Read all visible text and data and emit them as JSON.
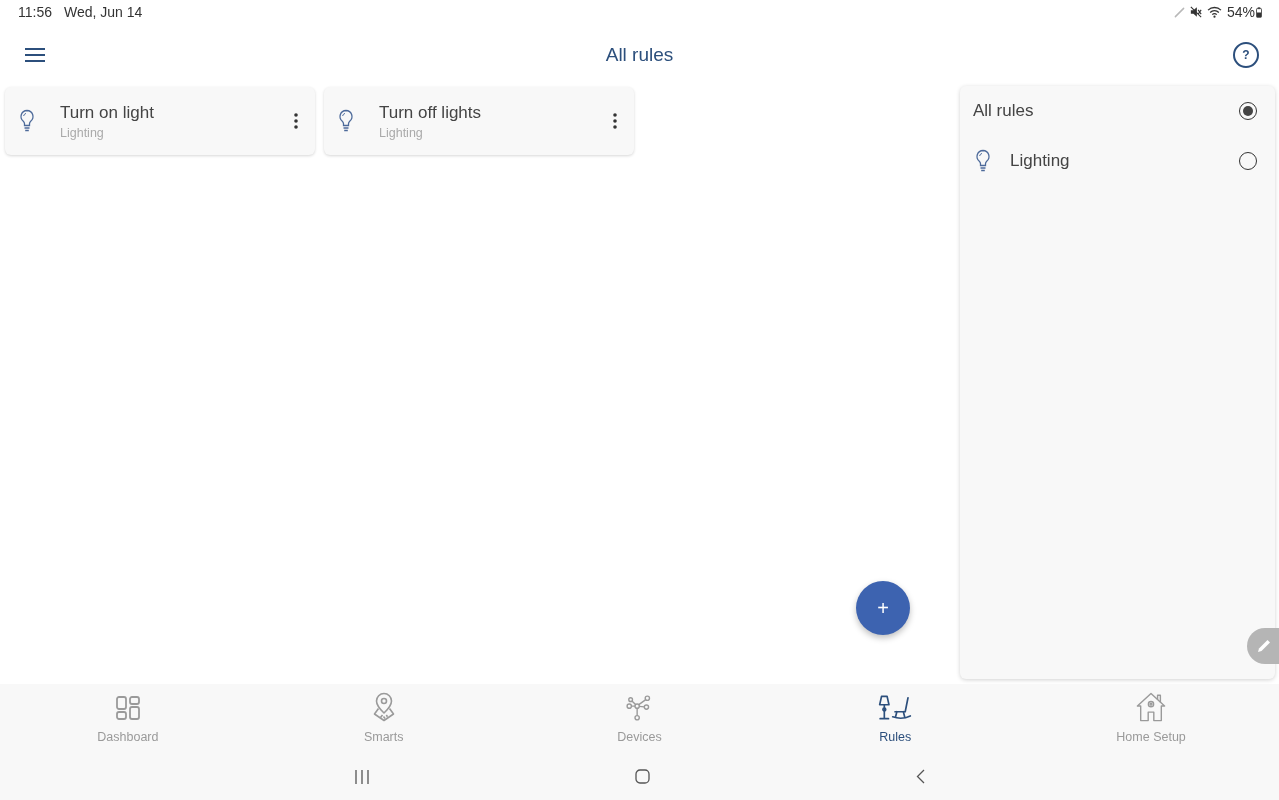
{
  "status_bar": {
    "time": "11:56",
    "date": "Wed, Jun 14",
    "battery": "54%"
  },
  "header": {
    "title": "All rules",
    "help": "?"
  },
  "rules": [
    {
      "title": "Turn on light",
      "category": "Lighting"
    },
    {
      "title": "Turn off lights",
      "category": "Lighting"
    }
  ],
  "filter_panel": {
    "options": [
      {
        "label": "All rules",
        "kind": "plain",
        "selected": true
      },
      {
        "label": "Lighting",
        "kind": "bulb",
        "selected": false
      }
    ]
  },
  "fab": {
    "label": "+"
  },
  "bottom_nav": [
    {
      "label": "Dashboard",
      "kind": "dashboard",
      "selected": false
    },
    {
      "label": "Smarts",
      "kind": "smarts",
      "selected": false
    },
    {
      "label": "Devices",
      "kind": "devices",
      "selected": false
    },
    {
      "label": "Rules",
      "kind": "rules",
      "selected": true
    },
    {
      "label": "Home Setup",
      "kind": "home_setup",
      "selected": false
    }
  ]
}
